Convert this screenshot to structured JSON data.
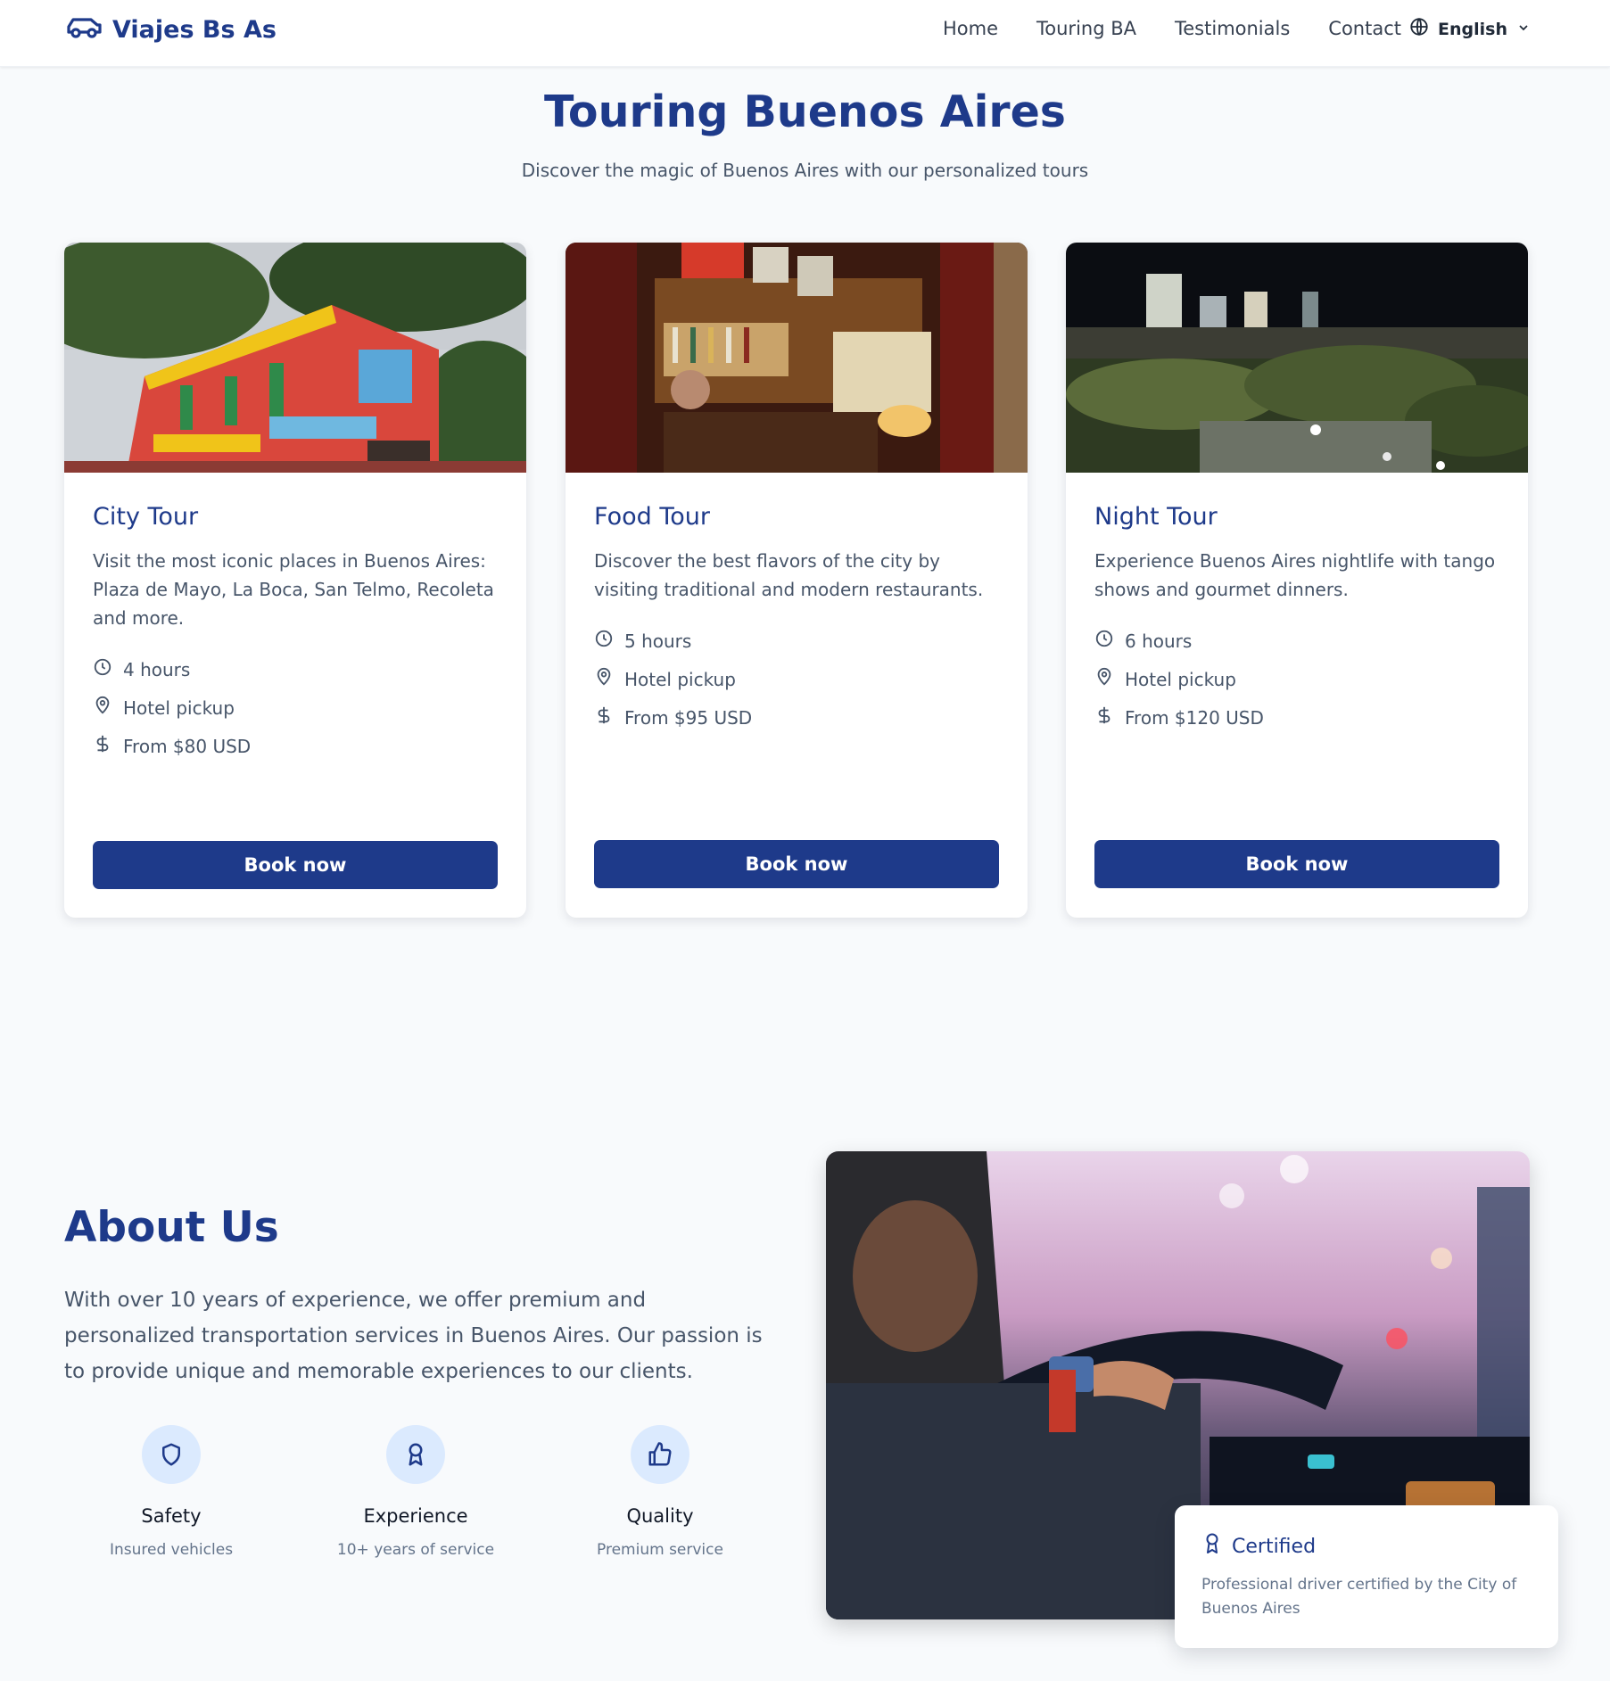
{
  "brand": {
    "name": "Viajes Bs As",
    "icon": "car-icon",
    "color": "#1e3a8a"
  },
  "nav": {
    "items": [
      "Home",
      "Touring BA",
      "Testimonials",
      "Contact"
    ],
    "language": "English"
  },
  "hero": {
    "title": "Touring Buenos Aires",
    "subtitle": "Discover the magic of Buenos Aires with our personalized tours"
  },
  "tours": [
    {
      "title": "City Tour",
      "description": "Visit the most iconic places in Buenos Aires: Plaza de Mayo, La Boca, San Telmo, Recoleta and more.",
      "duration": "4 hours",
      "pickup": "Hotel pickup",
      "price": "From $80 USD",
      "button": "Book now"
    },
    {
      "title": "Food Tour",
      "description": "Discover the best flavors of the city by visiting traditional and modern restaurants.",
      "duration": "5 hours",
      "pickup": "Hotel pickup",
      "price": "From $95 USD",
      "button": "Book now"
    },
    {
      "title": "Night Tour",
      "description": "Experience Buenos Aires nightlife with tango shows and gourmet dinners.",
      "duration": "6 hours",
      "pickup": "Hotel pickup",
      "price": "From $120 USD",
      "button": "Book now"
    }
  ],
  "about": {
    "title": "About Us",
    "text": "With over 10 years of experience, we offer premium and personalized transportation services in Buenos Aires. Our passion is to provide unique and memorable experiences to our clients.",
    "features": [
      {
        "title": "Safety",
        "subtitle": "Insured vehicles",
        "icon": "shield-icon"
      },
      {
        "title": "Experience",
        "subtitle": "10+ years of service",
        "icon": "award-icon"
      },
      {
        "title": "Quality",
        "subtitle": "Premium service",
        "icon": "thumbs-up-icon"
      }
    ],
    "badge": {
      "title": "Certified",
      "text": "Professional driver certified by the City of Buenos Aires",
      "icon": "award-icon"
    }
  }
}
